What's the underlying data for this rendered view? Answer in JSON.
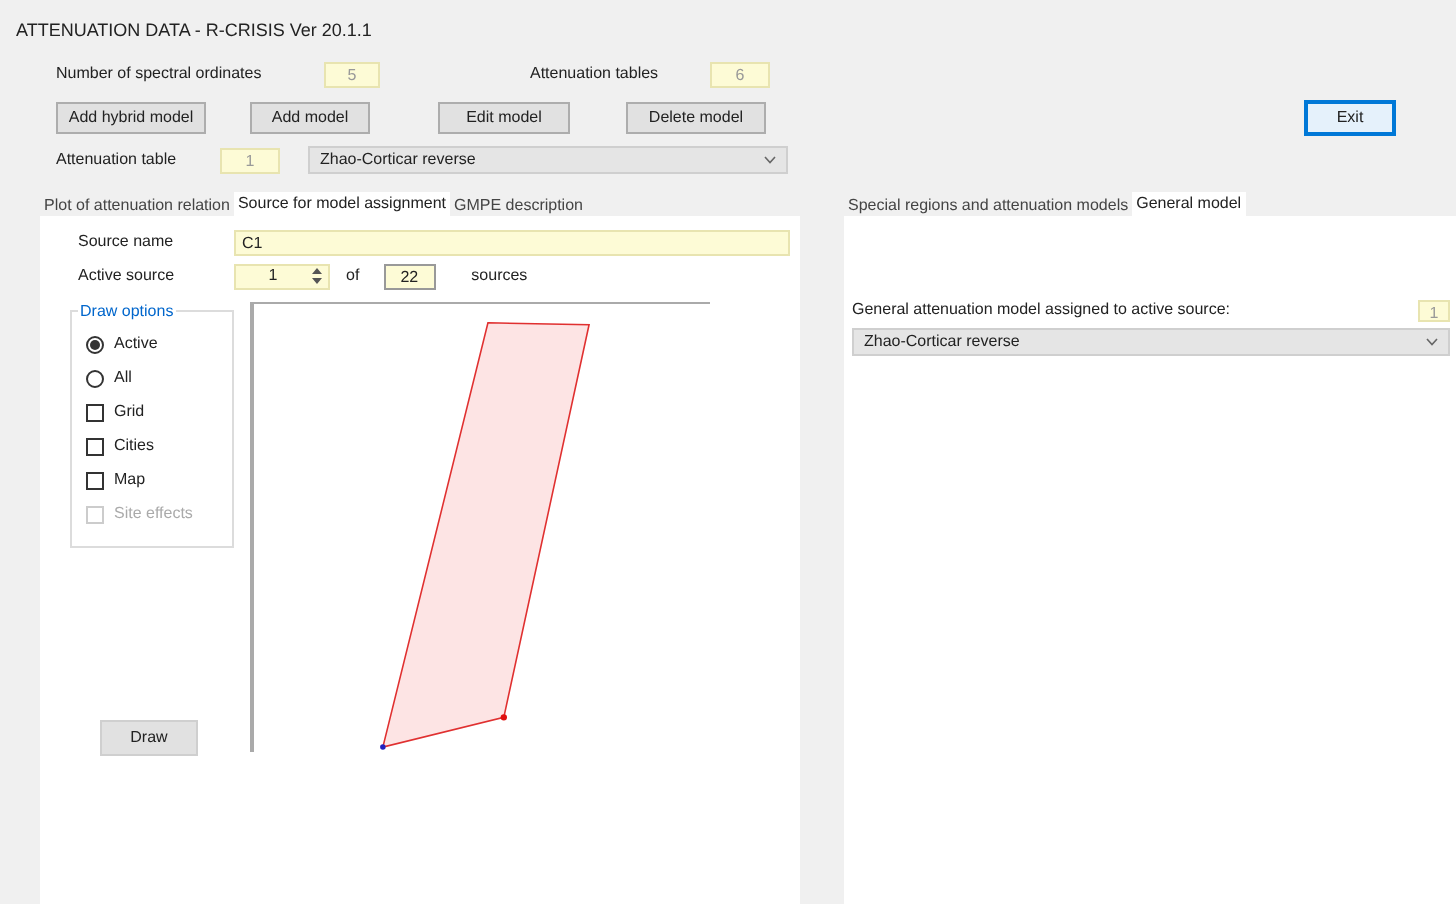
{
  "window": {
    "title": "ATTENUATION DATA - R-CRISIS Ver 20.1.1"
  },
  "spectral_ordinates": {
    "label": "Number of spectral ordinates",
    "value": "5"
  },
  "attenuation_tables": {
    "label": "Attenuation tables",
    "value": "6"
  },
  "buttons": [
    "Add hybrid model",
    "Add model",
    "Edit model",
    "Delete model"
  ],
  "exit_button": "Exit",
  "attenuation_table": {
    "label": "Attenuation table",
    "value": "1",
    "model": "Zhao-Corticar reverse"
  },
  "left_tabs": [
    {
      "label": "Plot of attenuation relation",
      "selected": false
    },
    {
      "label": "Source for model assignment",
      "selected": true
    },
    {
      "label": "GMPE description",
      "selected": false
    }
  ],
  "source_name": {
    "label": "Source name",
    "value": "C1"
  },
  "active_source": {
    "label": "Active source",
    "value": "1",
    "of": "of",
    "total": "22",
    "unit": "sources"
  },
  "draw_options": {
    "title": "Draw options",
    "items": [
      {
        "kind": "radio",
        "label": "Active",
        "selected": true,
        "disabled": false
      },
      {
        "kind": "radio",
        "label": "All",
        "selected": false,
        "disabled": false
      },
      {
        "kind": "checkbox",
        "label": "Grid",
        "checked": false,
        "disabled": false
      },
      {
        "kind": "checkbox",
        "label": "Cities",
        "checked": false,
        "disabled": false
      },
      {
        "kind": "checkbox",
        "label": "Map",
        "checked": false,
        "disabled": false
      },
      {
        "kind": "checkbox",
        "label": "Site effects",
        "checked": false,
        "disabled": true
      }
    ]
  },
  "draw_button": "Draw",
  "right_tabs": [
    {
      "label": "Special regions and attenuation models",
      "selected": false
    },
    {
      "label": "General model",
      "selected": true
    }
  ],
  "general_model": {
    "label": "General attenuation model assigned to active source:",
    "value": "1",
    "model": "Zhao-Corticar reverse"
  }
}
